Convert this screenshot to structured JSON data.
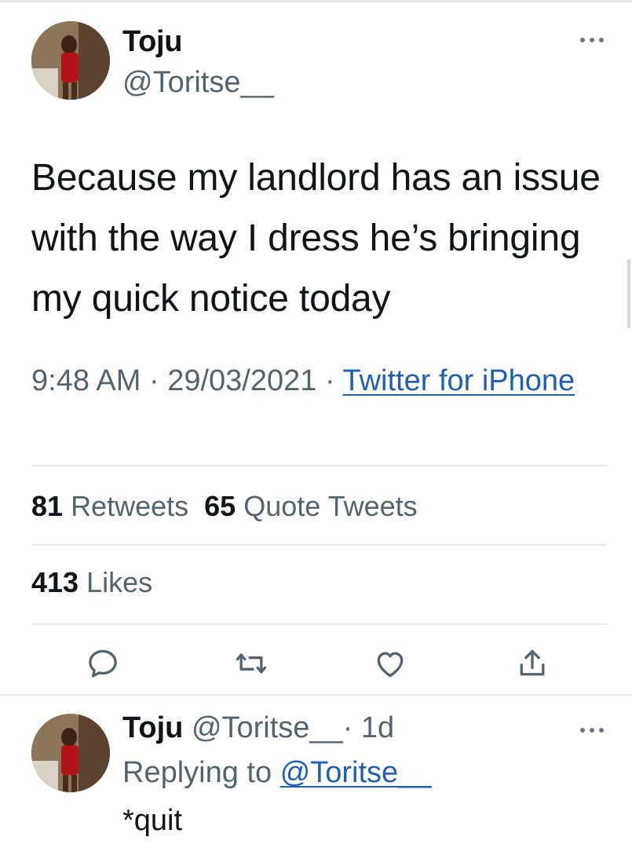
{
  "tweet": {
    "author_name": "Toju",
    "author_handle": "@Toritse__",
    "text": "Because my landlord has an issue with the way I dress he’s bringing my quick notice today",
    "time": "9:48 AM",
    "date": "29/03/2021",
    "separator": " · ",
    "source": "Twitter for iPhone",
    "more_icon": "more-horizontal-icon"
  },
  "stats": {
    "retweets_count": "81",
    "retweets_label": "Retweets",
    "quotes_count": "65",
    "quotes_label": "Quote Tweets",
    "likes_count": "413",
    "likes_label": "Likes"
  },
  "actions": [
    {
      "icon": "reply-icon"
    },
    {
      "icon": "retweet-icon"
    },
    {
      "icon": "like-icon"
    },
    {
      "icon": "share-icon"
    }
  ],
  "reply": {
    "author_name": "Toju",
    "author_handle": "@Toritse__",
    "time_ago": "· 1d",
    "replying_to_label": "Replying to",
    "replying_to_handle": "@Toritse__",
    "text": "*quit"
  },
  "colors": {
    "text": "#0f1419",
    "secondary": "#536471",
    "link": "#1f5fb8",
    "divider": "#e7e9ea"
  }
}
